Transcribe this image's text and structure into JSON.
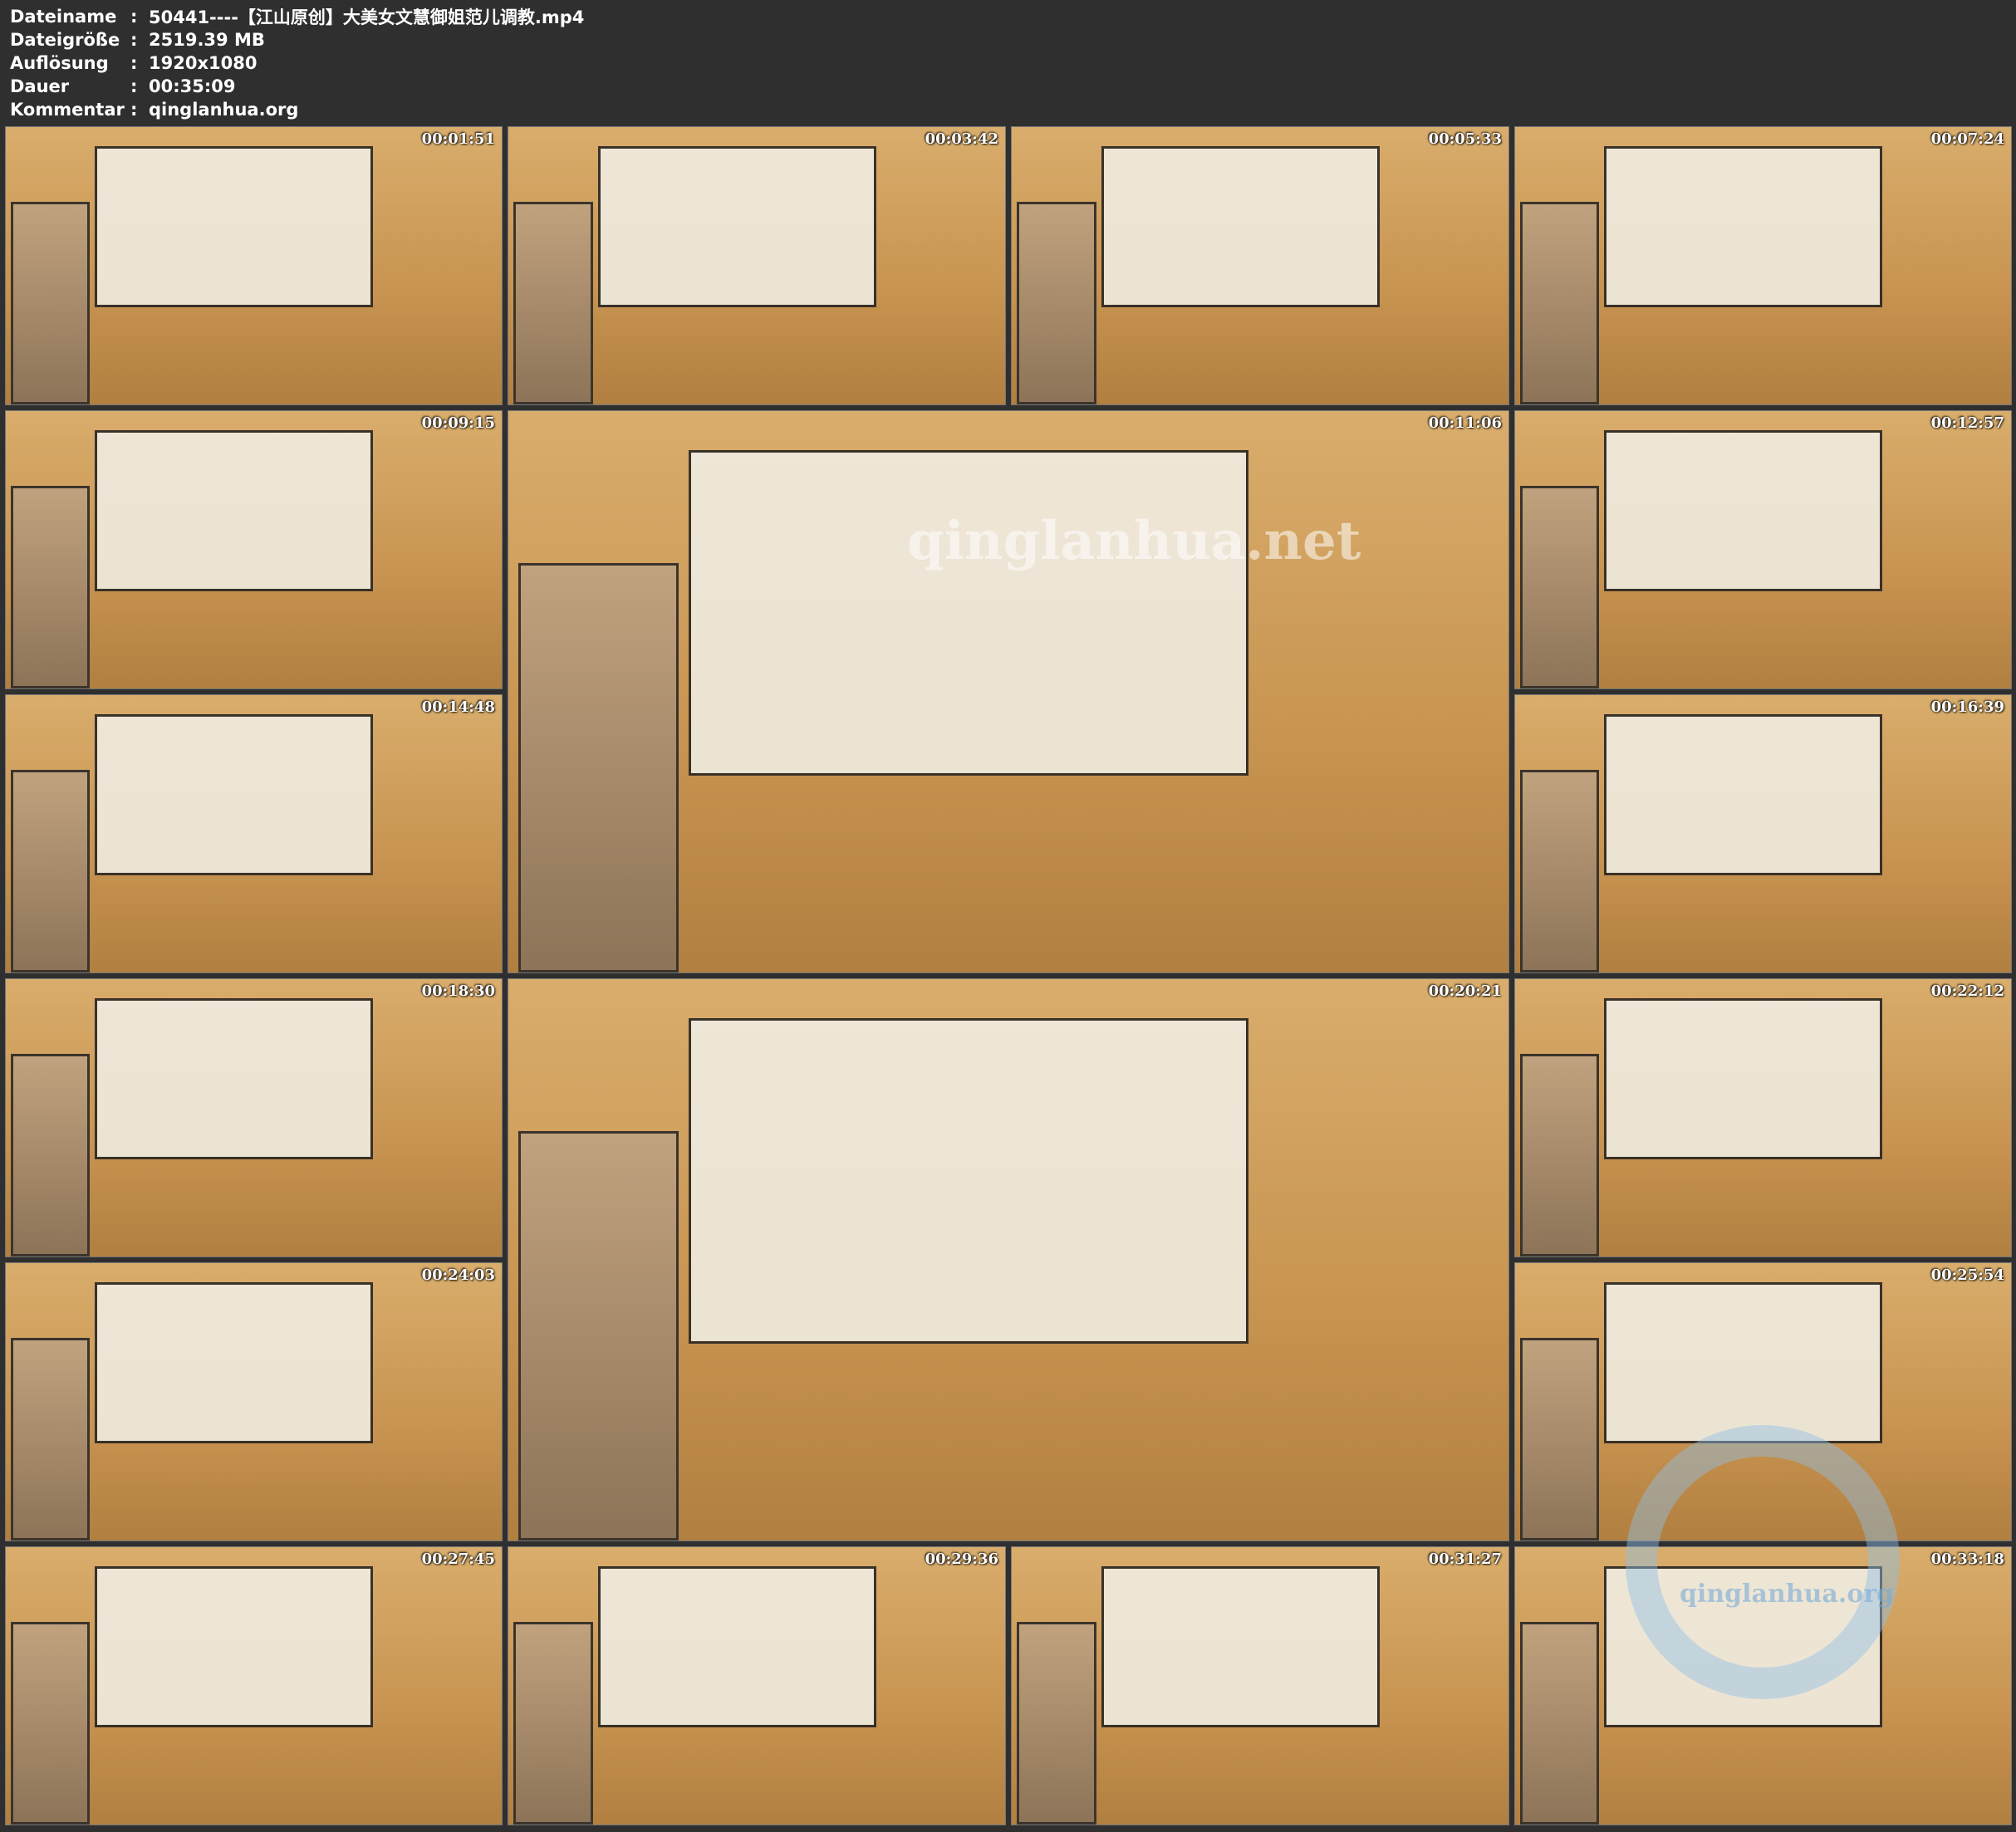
{
  "header": {
    "rows": [
      {
        "label": "Dateiname",
        "separator": ":",
        "value": "50441----【江山原创】大美女文慧御姐范儿调教.mp4"
      },
      {
        "label": "Dateigröße",
        "separator": ":",
        "value": "2519.39 MB"
      },
      {
        "label": "Auflösung",
        "separator": ":",
        "value": "1920x1080"
      },
      {
        "label": "Dauer",
        "separator": ":",
        "value": "00:35:09"
      },
      {
        "label": "Kommentar",
        "separator": ":",
        "value": "qinglanhua.org"
      }
    ]
  },
  "frames": [
    {
      "timecode": "00:01:51"
    },
    {
      "timecode": "00:03:42"
    },
    {
      "timecode": "00:05:33"
    },
    {
      "timecode": "00:07:24"
    },
    {
      "timecode": "00:09:15"
    },
    {
      "timecode": "00:11:06"
    },
    {
      "timecode": "00:12:57"
    },
    {
      "timecode": "00:14:48"
    },
    {
      "timecode": "00:16:39"
    },
    {
      "timecode": "00:18:30"
    },
    {
      "timecode": "00:20:21"
    },
    {
      "timecode": "00:22:12"
    },
    {
      "timecode": "00:24:03"
    },
    {
      "timecode": "00:25:54"
    },
    {
      "timecode": "00:27:45"
    },
    {
      "timecode": "00:29:36"
    },
    {
      "timecode": "00:31:27"
    },
    {
      "timecode": "00:33:18"
    }
  ],
  "watermarks": {
    "center_text": "qinglanhua.net",
    "corner_logo_text": "qinglanhua.org"
  }
}
